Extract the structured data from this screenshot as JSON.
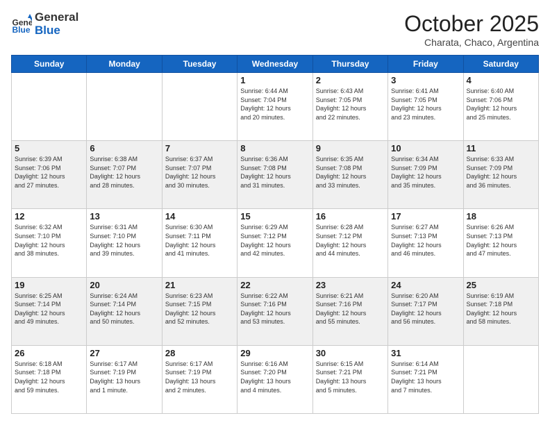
{
  "header": {
    "logo_general": "General",
    "logo_blue": "Blue",
    "month_title": "October 2025",
    "location": "Charata, Chaco, Argentina"
  },
  "weekdays": [
    "Sunday",
    "Monday",
    "Tuesday",
    "Wednesday",
    "Thursday",
    "Friday",
    "Saturday"
  ],
  "weeks": [
    [
      {
        "day": "",
        "info": ""
      },
      {
        "day": "",
        "info": ""
      },
      {
        "day": "",
        "info": ""
      },
      {
        "day": "1",
        "info": "Sunrise: 6:44 AM\nSunset: 7:04 PM\nDaylight: 12 hours\nand 20 minutes."
      },
      {
        "day": "2",
        "info": "Sunrise: 6:43 AM\nSunset: 7:05 PM\nDaylight: 12 hours\nand 22 minutes."
      },
      {
        "day": "3",
        "info": "Sunrise: 6:41 AM\nSunset: 7:05 PM\nDaylight: 12 hours\nand 23 minutes."
      },
      {
        "day": "4",
        "info": "Sunrise: 6:40 AM\nSunset: 7:06 PM\nDaylight: 12 hours\nand 25 minutes."
      }
    ],
    [
      {
        "day": "5",
        "info": "Sunrise: 6:39 AM\nSunset: 7:06 PM\nDaylight: 12 hours\nand 27 minutes."
      },
      {
        "day": "6",
        "info": "Sunrise: 6:38 AM\nSunset: 7:07 PM\nDaylight: 12 hours\nand 28 minutes."
      },
      {
        "day": "7",
        "info": "Sunrise: 6:37 AM\nSunset: 7:07 PM\nDaylight: 12 hours\nand 30 minutes."
      },
      {
        "day": "8",
        "info": "Sunrise: 6:36 AM\nSunset: 7:08 PM\nDaylight: 12 hours\nand 31 minutes."
      },
      {
        "day": "9",
        "info": "Sunrise: 6:35 AM\nSunset: 7:08 PM\nDaylight: 12 hours\nand 33 minutes."
      },
      {
        "day": "10",
        "info": "Sunrise: 6:34 AM\nSunset: 7:09 PM\nDaylight: 12 hours\nand 35 minutes."
      },
      {
        "day": "11",
        "info": "Sunrise: 6:33 AM\nSunset: 7:09 PM\nDaylight: 12 hours\nand 36 minutes."
      }
    ],
    [
      {
        "day": "12",
        "info": "Sunrise: 6:32 AM\nSunset: 7:10 PM\nDaylight: 12 hours\nand 38 minutes."
      },
      {
        "day": "13",
        "info": "Sunrise: 6:31 AM\nSunset: 7:10 PM\nDaylight: 12 hours\nand 39 minutes."
      },
      {
        "day": "14",
        "info": "Sunrise: 6:30 AM\nSunset: 7:11 PM\nDaylight: 12 hours\nand 41 minutes."
      },
      {
        "day": "15",
        "info": "Sunrise: 6:29 AM\nSunset: 7:12 PM\nDaylight: 12 hours\nand 42 minutes."
      },
      {
        "day": "16",
        "info": "Sunrise: 6:28 AM\nSunset: 7:12 PM\nDaylight: 12 hours\nand 44 minutes."
      },
      {
        "day": "17",
        "info": "Sunrise: 6:27 AM\nSunset: 7:13 PM\nDaylight: 12 hours\nand 46 minutes."
      },
      {
        "day": "18",
        "info": "Sunrise: 6:26 AM\nSunset: 7:13 PM\nDaylight: 12 hours\nand 47 minutes."
      }
    ],
    [
      {
        "day": "19",
        "info": "Sunrise: 6:25 AM\nSunset: 7:14 PM\nDaylight: 12 hours\nand 49 minutes."
      },
      {
        "day": "20",
        "info": "Sunrise: 6:24 AM\nSunset: 7:14 PM\nDaylight: 12 hours\nand 50 minutes."
      },
      {
        "day": "21",
        "info": "Sunrise: 6:23 AM\nSunset: 7:15 PM\nDaylight: 12 hours\nand 52 minutes."
      },
      {
        "day": "22",
        "info": "Sunrise: 6:22 AM\nSunset: 7:16 PM\nDaylight: 12 hours\nand 53 minutes."
      },
      {
        "day": "23",
        "info": "Sunrise: 6:21 AM\nSunset: 7:16 PM\nDaylight: 12 hours\nand 55 minutes."
      },
      {
        "day": "24",
        "info": "Sunrise: 6:20 AM\nSunset: 7:17 PM\nDaylight: 12 hours\nand 56 minutes."
      },
      {
        "day": "25",
        "info": "Sunrise: 6:19 AM\nSunset: 7:18 PM\nDaylight: 12 hours\nand 58 minutes."
      }
    ],
    [
      {
        "day": "26",
        "info": "Sunrise: 6:18 AM\nSunset: 7:18 PM\nDaylight: 12 hours\nand 59 minutes."
      },
      {
        "day": "27",
        "info": "Sunrise: 6:17 AM\nSunset: 7:19 PM\nDaylight: 13 hours\nand 1 minute."
      },
      {
        "day": "28",
        "info": "Sunrise: 6:17 AM\nSunset: 7:19 PM\nDaylight: 13 hours\nand 2 minutes."
      },
      {
        "day": "29",
        "info": "Sunrise: 6:16 AM\nSunset: 7:20 PM\nDaylight: 13 hours\nand 4 minutes."
      },
      {
        "day": "30",
        "info": "Sunrise: 6:15 AM\nSunset: 7:21 PM\nDaylight: 13 hours\nand 5 minutes."
      },
      {
        "day": "31",
        "info": "Sunrise: 6:14 AM\nSunset: 7:21 PM\nDaylight: 13 hours\nand 7 minutes."
      },
      {
        "day": "",
        "info": ""
      }
    ]
  ]
}
